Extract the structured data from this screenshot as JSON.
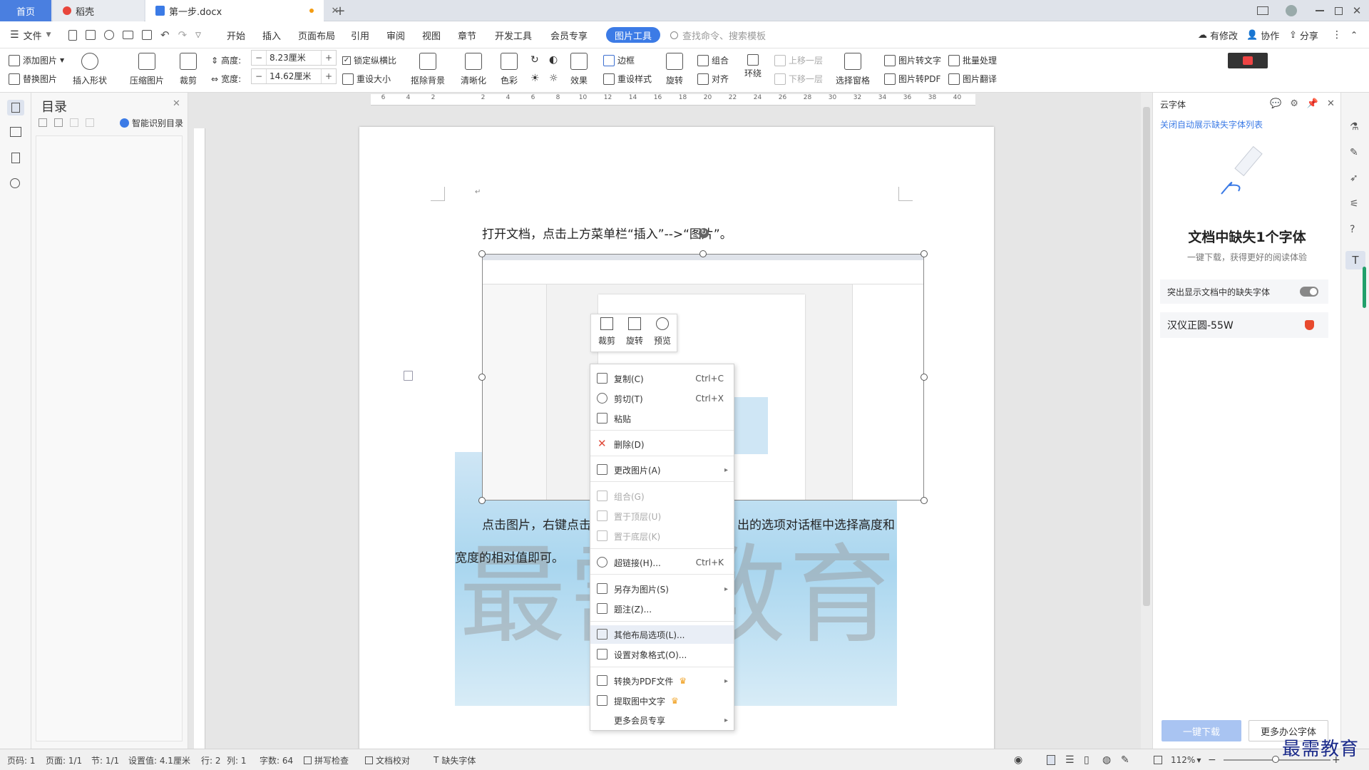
{
  "tabs": {
    "home": "首页",
    "docer": "稻壳",
    "doc": "第一步.docx"
  },
  "menu": {
    "file": "文件",
    "items": [
      "开始",
      "插入",
      "页面布局",
      "引用",
      "审阅",
      "视图",
      "章节",
      "开发工具",
      "会员专享"
    ],
    "picture_tool": "图片工具",
    "search_placeholder": "查找命令、搜索模板",
    "modified": "有修改",
    "collab": "协作",
    "share": "分享"
  },
  "ribbon": {
    "add_picture": "添加图片",
    "replace_picture": "替换图片",
    "insert_shape": "插入形状",
    "compress_picture": "压缩图片",
    "crop": "裁剪",
    "height_label": "高度:",
    "height_value": "8.23厘米",
    "width_label": "宽度:",
    "width_value": "14.62厘米",
    "lock_ratio": "锁定纵横比",
    "reset_size": "重设大小",
    "remove_bg": "抠除背景",
    "sharpen": "清晰化",
    "color": "色彩",
    "effect": "效果",
    "border": "边框",
    "reset_style": "重设样式",
    "rotate": "旋转",
    "group": "组合",
    "align": "对齐",
    "wrap": "环绕",
    "bring_forward": "上移一层",
    "send_backward": "下移一层",
    "select_pane": "选择窗格",
    "pic_to_text": "图片转文字",
    "pic_to_pdf": "图片转PDF",
    "batch": "批量处理",
    "pic_translate": "图片翻译"
  },
  "toc": {
    "title": "目录",
    "smart": "智能识别目录"
  },
  "ruler_ticks": [
    "6",
    "4",
    "2",
    "",
    "2",
    "4",
    "6",
    "8",
    "10",
    "12",
    "14",
    "16",
    "18",
    "20",
    "22",
    "24",
    "26",
    "28",
    "30",
    "32",
    "34",
    "36",
    "38",
    "40"
  ],
  "document": {
    "line1": "打开文档，点击上方菜单栏“插入”-->“图片”。",
    "line2": "点击图片，右键点击",
    "line2b": "出的选项对话框中选择高度和",
    "line3": "宽度的相对值即可。",
    "watermark": "最需教育"
  },
  "mini_toolbar": {
    "crop": "裁剪",
    "rotate": "旋转",
    "preview": "预览"
  },
  "context_menu": {
    "copy": "复制(C)",
    "copy_key": "Ctrl+C",
    "cut": "剪切(T)",
    "cut_key": "Ctrl+X",
    "paste": "粘贴",
    "delete": "删除(D)",
    "change_picture": "更改图片(A)",
    "group": "组合(G)",
    "bring_top": "置于顶层(U)",
    "send_bottom": "置于底层(K)",
    "hyperlink": "超链接(H)...",
    "hyperlink_key": "Ctrl+K",
    "save_as_picture": "另存为图片(S)",
    "caption": "题注(Z)...",
    "layout_options": "其他布局选项(L)...",
    "format_object": "设置对象格式(O)...",
    "to_pdf": "转换为PDF文件",
    "extract_text": "提取图中文字",
    "more_vip": "更多会员专享"
  },
  "right_panel": {
    "title": "云字体",
    "link": "关闭自动展示缺失字体列表",
    "headline": "文档中缺失1个字体",
    "subline": "一键下载，获得更好的阅读体验",
    "highlight_toggle": "突出显示文档中的缺失字体",
    "font_name": "汉仪正圆-55W",
    "download": "一键下载",
    "more_fonts": "更多办公字体"
  },
  "status": {
    "page_code": "页码: 1",
    "pages": "页面: 1/1",
    "section": "节: 1/1",
    "setting": "设置值: 4.1厘米",
    "row": "行: 2",
    "col": "列: 1",
    "words": "字数: 64",
    "spell": "拼写检查",
    "proof": "文档校对",
    "missing_font": "缺失字体",
    "zoom": "112%"
  },
  "watermark_logo": "最需教育"
}
